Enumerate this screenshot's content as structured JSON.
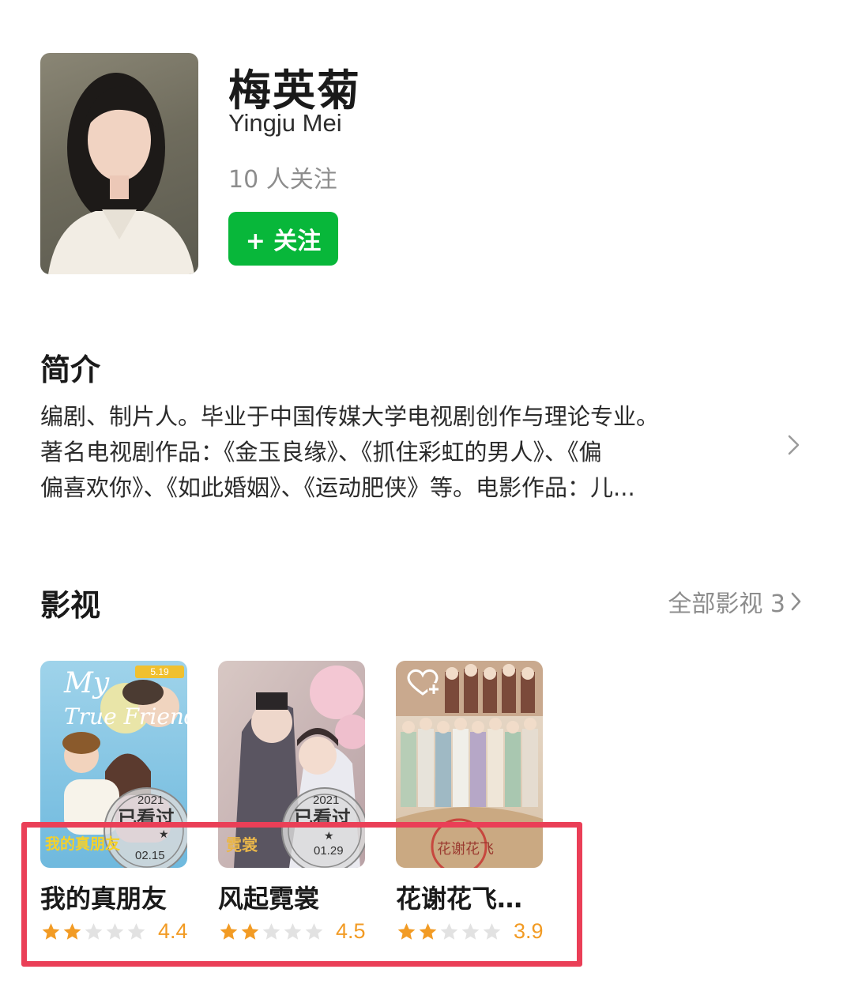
{
  "profile": {
    "name_cn": "梅英菊",
    "name_en": "Yingju Mei",
    "followers": "10 人关注",
    "follow_label": "+ 关注"
  },
  "intro": {
    "title": "简介",
    "lines": [
      "编剧、制片人。毕业于中国传媒大学电视剧创作与理论专业。",
      "著名电视剧作品：《金玉良缘》、《抓住彩虹的男人》、《偏",
      "偏喜欢你》、《如此婚姻》、《运动肥侠》等。电影作品：儿..."
    ]
  },
  "works": {
    "title": "影视",
    "all_label": "全部影视 3",
    "items": [
      {
        "title": "我的真朋友",
        "rating": 2,
        "score": "4.4",
        "poster": {
          "top_text": "My",
          "mid_text": "True Friend",
          "badge": "5.19",
          "stamp_year": "2021",
          "stamp_text": "已看过",
          "stamp_date": "02.15",
          "logo_text": "我的真朋友"
        }
      },
      {
        "title": "风起霓裳",
        "rating": 2,
        "score": "4.5",
        "poster": {
          "stamp_year": "2021",
          "stamp_text": "已看过",
          "stamp_date": "01.29",
          "logo_text": "霓裳"
        }
      },
      {
        "title": "花谢花飞…",
        "rating": 2,
        "score": "3.9",
        "poster": {
          "logo_text": "花谢花飞"
        }
      }
    ]
  },
  "colors": {
    "follow_green": "#08b73a",
    "star_filled": "#f29b24",
    "star_empty": "#e2e2e2",
    "highlight": "#ea3f57"
  }
}
